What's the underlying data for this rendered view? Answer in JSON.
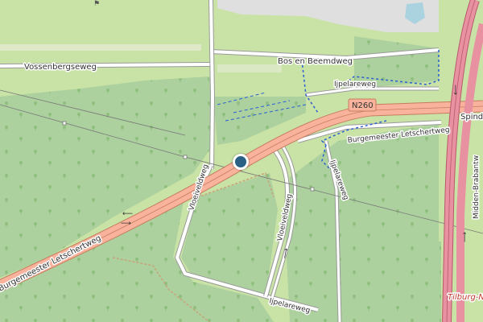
{
  "map": {
    "colors": {
      "land": "#c9e3a6",
      "forest": "#add19e",
      "motorway": "#e891a1",
      "trunk": "#f9b29c",
      "road": "#ffffff",
      "path": "#2a5fd4",
      "marker": "#2a5f86"
    },
    "labels": {
      "vossenbergseweg": "Vossenbergseweg",
      "bos_en_beemdweg": "Bos en Beemdweg",
      "ijpelareweg_top": "Ijpelareweg",
      "n260": "N260",
      "spinder": "Spind",
      "burgemeester_letschertweg_right": "Burgemeester Letschertweg",
      "vloeiveldweg_left": "Vloeiveldweg",
      "vloeiveldweg_right": "Vloeiveldweg",
      "ijpelareweg_mid": "Ijpelareweg",
      "ijpelareweg_bottom": "Ijpelareweg",
      "midden_brabantweg": "Midden-Brabantw",
      "burgemeester_letschertweg_left": "Burgemeester Letschertweg",
      "tilburg": "Tilburg-N"
    },
    "marker": {
      "label": "selected location"
    }
  }
}
